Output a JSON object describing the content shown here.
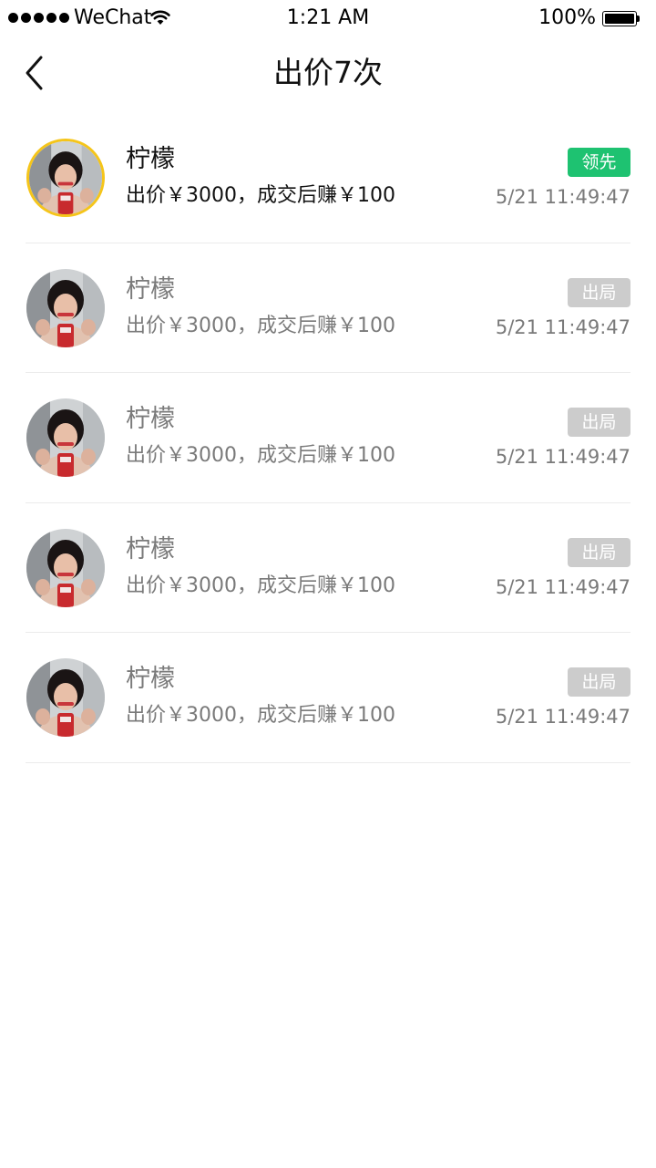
{
  "status_bar": {
    "carrier": "WeChat",
    "time": "1:21 AM",
    "battery": "100%",
    "battery_level": 1.0,
    "signal_bars": 5,
    "signal_icon": "signal-dots-icon",
    "wifi_icon": "wifi-icon",
    "battery_icon": "battery-icon"
  },
  "nav": {
    "title": "出价7次",
    "back_icon": "chevron-left-icon"
  },
  "colors": {
    "leading_badge": "#1ec271",
    "out_badge": "#cccccc",
    "leader_ring": "#f5c51a",
    "divider": "#ebebeb",
    "muted_text": "#7a7a7a"
  },
  "bids": [
    {
      "name": "柠檬",
      "desc": "出价￥3000，成交后赚￥100",
      "status": "领先",
      "time": "5/21 11:49:47",
      "leader": true
    },
    {
      "name": "柠檬",
      "desc": "出价￥3000，成交后赚￥100",
      "status": "出局",
      "time": "5/21 11:49:47",
      "leader": false
    },
    {
      "name": "柠檬",
      "desc": "出价￥3000，成交后赚￥100",
      "status": "出局",
      "time": "5/21 11:49:47",
      "leader": false
    },
    {
      "name": "柠檬",
      "desc": "出价￥3000，成交后赚￥100",
      "status": "出局",
      "time": "5/21 11:49:47",
      "leader": false
    },
    {
      "name": "柠檬",
      "desc": "出价￥3000，成交后赚￥100",
      "status": "出局",
      "time": "5/21 11:49:47",
      "leader": false
    }
  ]
}
